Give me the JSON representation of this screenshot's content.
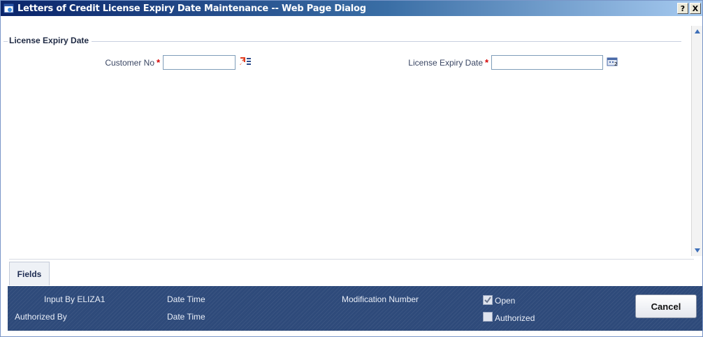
{
  "window": {
    "title": "Letters of Credit License Expiry Date Maintenance -- Web Page Dialog",
    "help_label": "?",
    "close_label": "X"
  },
  "section": {
    "legend": "License Expiry Date"
  },
  "form": {
    "customer_no": {
      "label": "Customer No",
      "required_mark": "*",
      "value": ""
    },
    "license_expiry_date": {
      "label": "License Expiry Date",
      "required_mark": "*",
      "value": ""
    }
  },
  "tabs": [
    {
      "label": "Fields"
    }
  ],
  "footer": {
    "input_by": "Input By ELIZA1",
    "authorized_by": "Authorized By",
    "date_time_1": "Date Time",
    "date_time_2": "Date Time",
    "modification_number": "Modification Number",
    "open": {
      "label": "Open",
      "checked": true
    },
    "authorized": {
      "label": "Authorized",
      "checked": false
    },
    "cancel_label": "Cancel"
  },
  "icons": {
    "title": "ie-dialog-icon",
    "lov": "list-of-values-icon",
    "calendar": "calendar-icon"
  },
  "colors": {
    "footer_bg": "#2e4a7a",
    "required": "#d40000",
    "title_bar_start": "#0a246a"
  }
}
